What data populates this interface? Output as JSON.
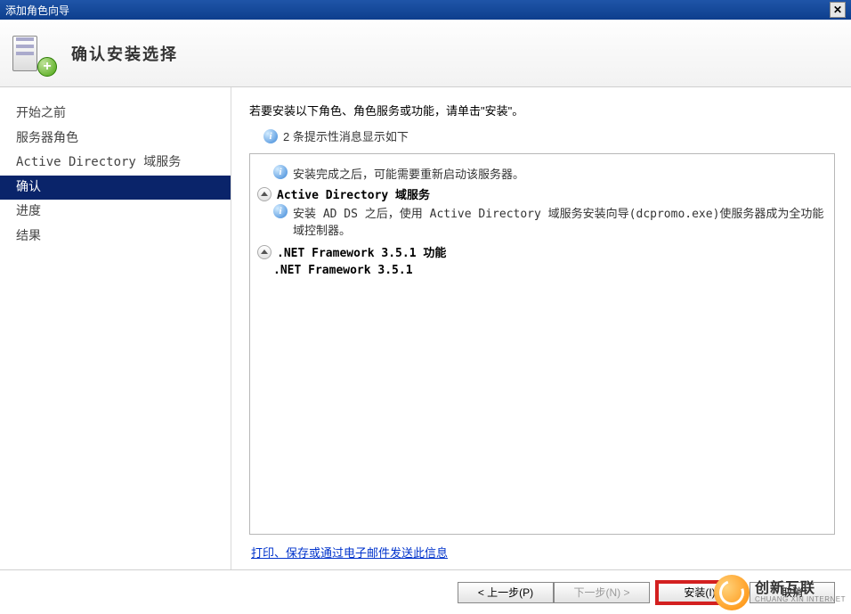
{
  "window": {
    "title": "添加角色向导",
    "heading": "确认安装选择"
  },
  "sidebar": {
    "items": [
      {
        "label": "开始之前",
        "selected": false
      },
      {
        "label": "服务器角色",
        "selected": false
      },
      {
        "label": "Active Directory 域服务",
        "selected": false
      },
      {
        "label": "确认",
        "selected": true
      },
      {
        "label": "进度",
        "selected": false
      },
      {
        "label": "结果",
        "selected": false
      }
    ]
  },
  "content": {
    "intro": "若要安装以下角色、角色服务或功能，请单击\"安装\"。",
    "hint": "2 条提示性消息显示如下",
    "sections": [
      {
        "note": "安装完成之后，可能需要重新启动该服务器。",
        "title": "Active Directory 域服务",
        "body": "安装 AD DS 之后，使用 Active Directory 域服务安装向导(dcpromo.exe)使服务器成为全功能域控制器。"
      },
      {
        "title": ".NET Framework 3.5.1 功能",
        "child": ".NET Framework 3.5.1"
      }
    ],
    "print_link": "打印、保存或通过电子邮件发送此信息"
  },
  "buttons": {
    "prev": "< 上一步(P)",
    "next": "下一步(N) >",
    "install": "安装(I)",
    "cancel": "取消"
  },
  "watermark": {
    "cn": "创新互联",
    "en": "CHUANG XIN INTERNET"
  }
}
